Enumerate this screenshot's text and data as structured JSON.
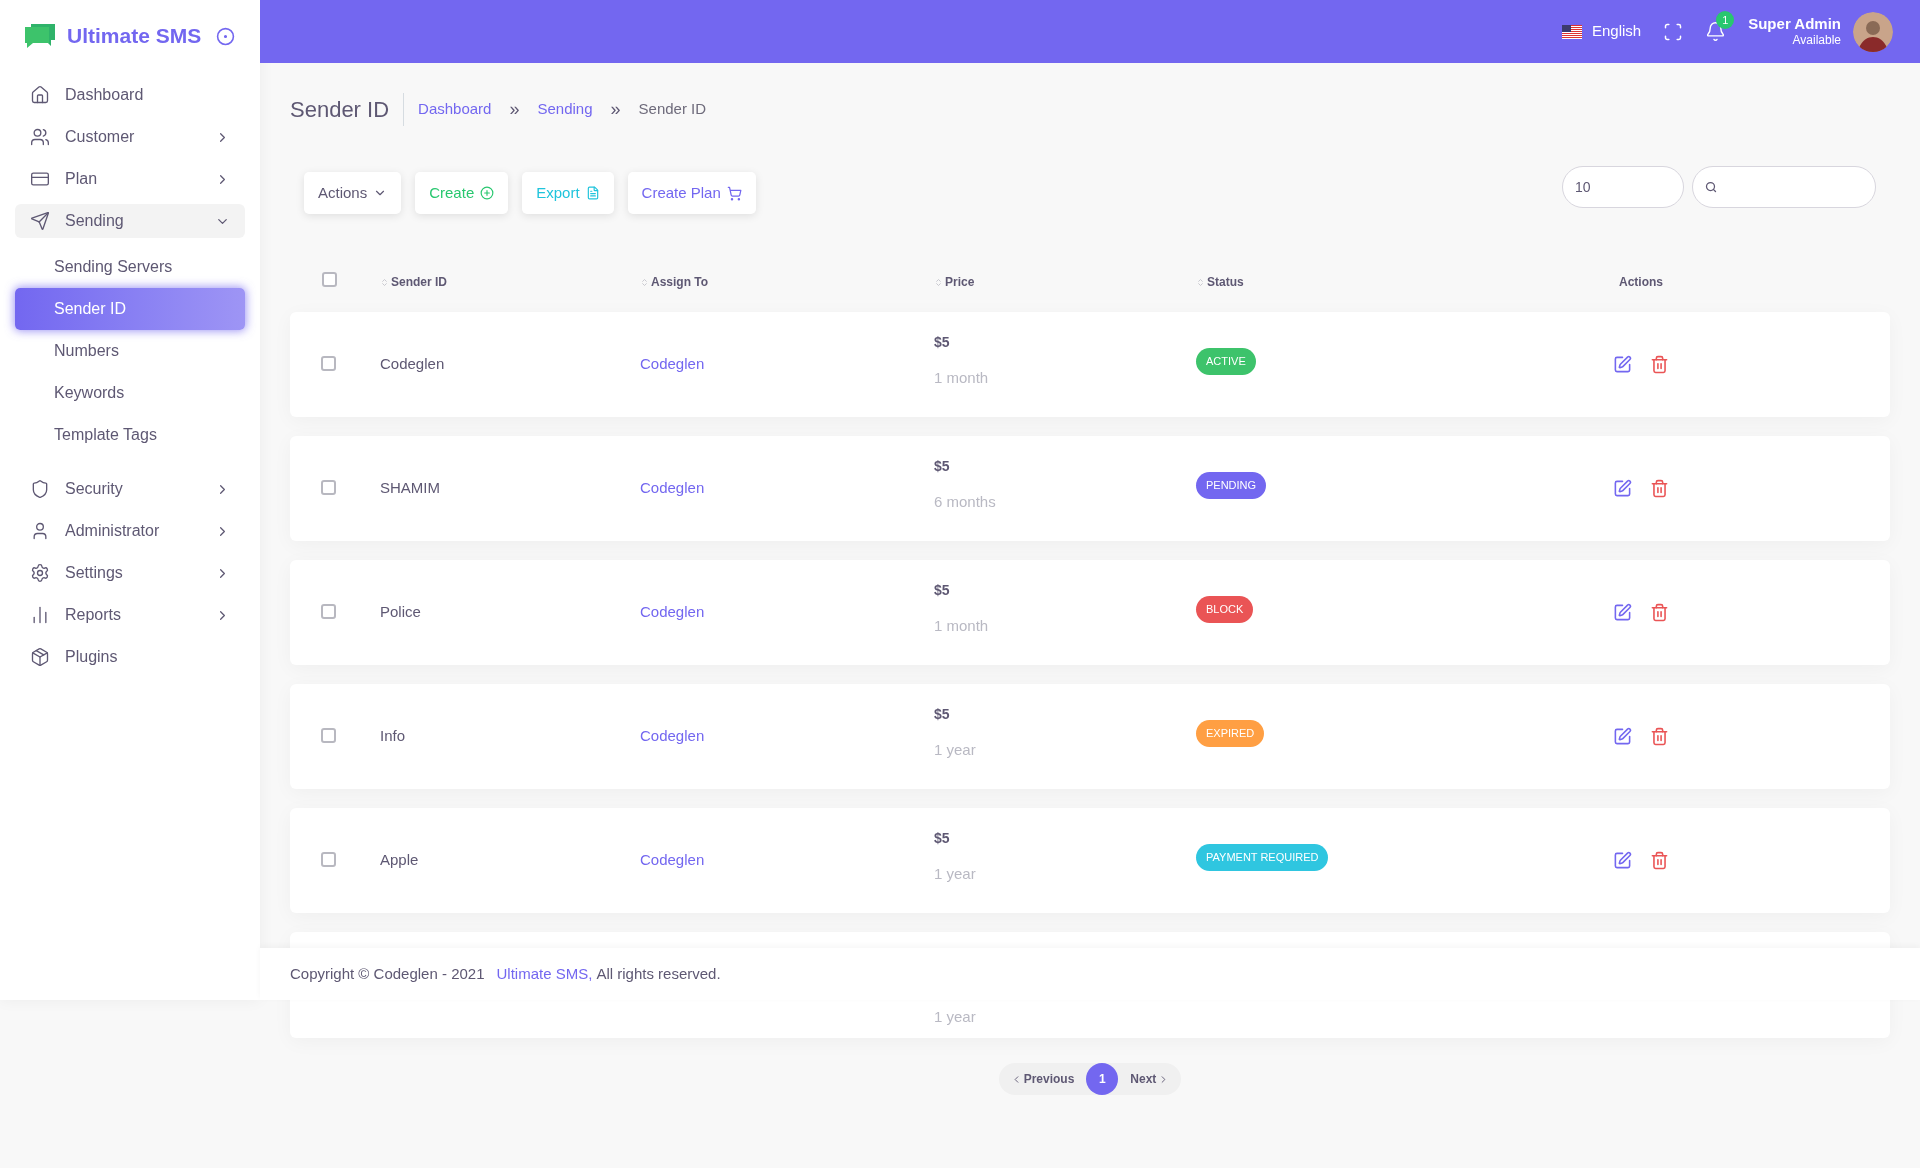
{
  "brand": {
    "name": "Ultimate SMS"
  },
  "sidebar": {
    "items": [
      {
        "label": "Dashboard",
        "kind": "link"
      },
      {
        "label": "Customer",
        "kind": "group",
        "expanded": false
      },
      {
        "label": "Plan",
        "kind": "group",
        "expanded": false
      },
      {
        "label": "Sending",
        "kind": "group",
        "expanded": true,
        "children": [
          {
            "label": "Sending Servers",
            "selected": false
          },
          {
            "label": "Sender ID",
            "selected": true
          },
          {
            "label": "Numbers",
            "selected": false
          },
          {
            "label": "Keywords",
            "selected": false
          },
          {
            "label": "Template Tags",
            "selected": false
          }
        ]
      },
      {
        "label": "Security",
        "kind": "group",
        "expanded": false
      },
      {
        "label": "Administrator",
        "kind": "group",
        "expanded": false
      },
      {
        "label": "Settings",
        "kind": "group",
        "expanded": false
      },
      {
        "label": "Reports",
        "kind": "group",
        "expanded": false
      },
      {
        "label": "Plugins",
        "kind": "link"
      }
    ]
  },
  "header": {
    "language": "English",
    "notification_count": "1",
    "user_name": "Super Admin",
    "user_status": "Available"
  },
  "page": {
    "title": "Sender ID",
    "breadcrumb": [
      {
        "label": "Dashboard",
        "kind": "link"
      },
      {
        "label": "»",
        "kind": "separator"
      },
      {
        "label": "Sending",
        "kind": "link"
      },
      {
        "label": "»",
        "kind": "separator"
      },
      {
        "label": "Sender ID",
        "kind": "current"
      }
    ]
  },
  "toolbar": {
    "buttons": [
      {
        "label": "Actions",
        "kind": "dropdown"
      },
      {
        "label": "Create",
        "kind": "create"
      },
      {
        "label": "Export",
        "kind": "export"
      },
      {
        "label": "Create Plan",
        "kind": "plan"
      }
    ],
    "page_size": "10"
  },
  "table": {
    "select_all": {
      "checked": false
    },
    "columns": [
      "Sender ID",
      "Assign To",
      "Price",
      "Status",
      "Actions"
    ],
    "rows": [
      {
        "checked": false,
        "sender_id": "Codeglen",
        "assign_to": "Codeglen",
        "price": "$5",
        "period": "1 month",
        "status": {
          "label": "ACTIVE",
          "color": "#3dc36b"
        }
      },
      {
        "checked": false,
        "sender_id": "SHAMIM",
        "assign_to": "Codeglen",
        "price": "$5",
        "period": "6 months",
        "status": {
          "label": "PENDING",
          "color": "#7367f0"
        }
      },
      {
        "checked": false,
        "sender_id": "Police",
        "assign_to": "Codeglen",
        "price": "$5",
        "period": "1 month",
        "status": {
          "label": "BLOCK",
          "color": "#ea5455"
        }
      },
      {
        "checked": false,
        "sender_id": "Info",
        "assign_to": "Codeglen",
        "price": "$5",
        "period": "1 year",
        "status": {
          "label": "EXPIRED",
          "color": "#ff9f43"
        }
      },
      {
        "checked": false,
        "sender_id": "Apple",
        "assign_to": "Codeglen",
        "price": "$5",
        "period": "1 year",
        "status": {
          "label": "PAYMENT REQUIRED",
          "color": "#2fc6e0"
        }
      }
    ],
    "partial_row": {
      "period": "1 year"
    }
  },
  "footer": {
    "text": "Copyright © Codeglen - 2021",
    "link": "Ultimate SMS,",
    "suffix": "All rights reserved."
  },
  "pagination": {
    "previous": "Previous",
    "next": "Next",
    "pages": [
      {
        "label": "1",
        "selected": true
      }
    ]
  }
}
